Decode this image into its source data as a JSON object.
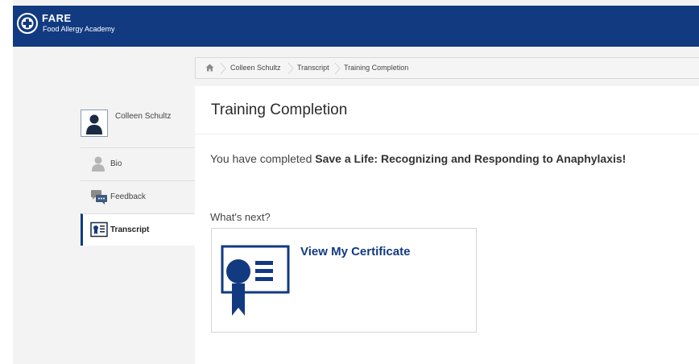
{
  "header": {
    "brand_name": "FARE",
    "brand_subtitle": "Food Allergy Academy",
    "color": "#123a80"
  },
  "breadcrumb": {
    "home_icon": "home-icon",
    "items": [
      "Colleen Schultz",
      "Transcript",
      "Training Completion"
    ]
  },
  "sidebar": {
    "user_name": "Colleen Schultz",
    "items": [
      {
        "label": "Bio",
        "icon": "person-icon",
        "active": false
      },
      {
        "label": "Feedback",
        "icon": "chat-bubbles-icon",
        "active": false
      },
      {
        "label": "Transcript",
        "icon": "id-card-icon",
        "active": true
      }
    ]
  },
  "main": {
    "title": "Training Completion",
    "completion_prefix": "You have completed ",
    "course_name": "Save a Life: Recognizing and Responding to Anaphylaxis!",
    "whats_next": "What's next?",
    "certificate_link": "View My Certificate",
    "accent_color": "#123a80"
  }
}
